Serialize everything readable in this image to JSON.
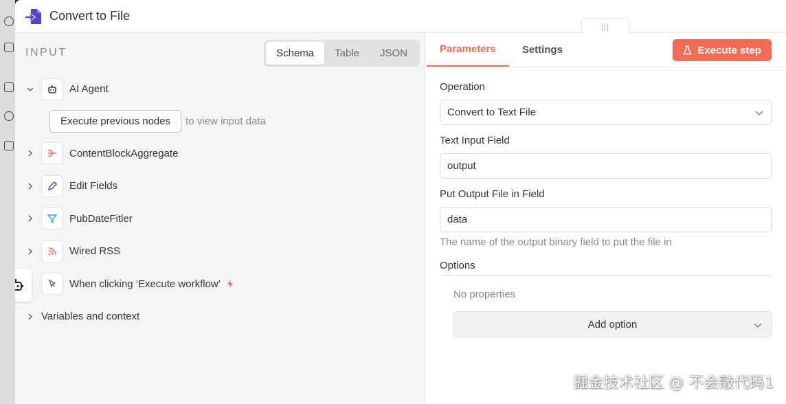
{
  "header": {
    "title": "Convert to File"
  },
  "input": {
    "title": "INPUT",
    "view_tabs": [
      "Schema",
      "Table",
      "JSON"
    ],
    "active_view": "Schema",
    "nodes": [
      {
        "label": "AI Agent",
        "icon": "robot-icon",
        "expanded": true
      },
      {
        "label": "ContentBlockAggregate",
        "icon": "aggregate-icon"
      },
      {
        "label": "Edit Fields",
        "icon": "pencil-icon"
      },
      {
        "label": "PubDateFitler",
        "icon": "filter-icon"
      },
      {
        "label": "Wired RSS",
        "icon": "rss-icon"
      },
      {
        "label": "When clicking ‘Execute workflow’",
        "icon": "pointer-icon"
      }
    ],
    "execute_previous": "Execute previous nodes",
    "execute_hint": "to view input data",
    "variables_label": "Variables and context"
  },
  "params": {
    "tabs": [
      "Parameters",
      "Settings"
    ],
    "active_tab": "Parameters",
    "execute_step": "Execute step",
    "operation_label": "Operation",
    "operation_value": "Convert to Text File",
    "text_input_label": "Text Input Field",
    "text_input_value": "output",
    "output_field_label": "Put Output File in Field",
    "output_field_value": "data",
    "output_field_hint": "The name of the output binary field to put the file in",
    "options_label": "Options",
    "no_properties": "No properties",
    "add_option": "Add option"
  },
  "watermark": "掘金技术社区 @ 不会敲代码1",
  "colors": {
    "accent": "#f26b54",
    "node_icon": "#4f46c8"
  }
}
